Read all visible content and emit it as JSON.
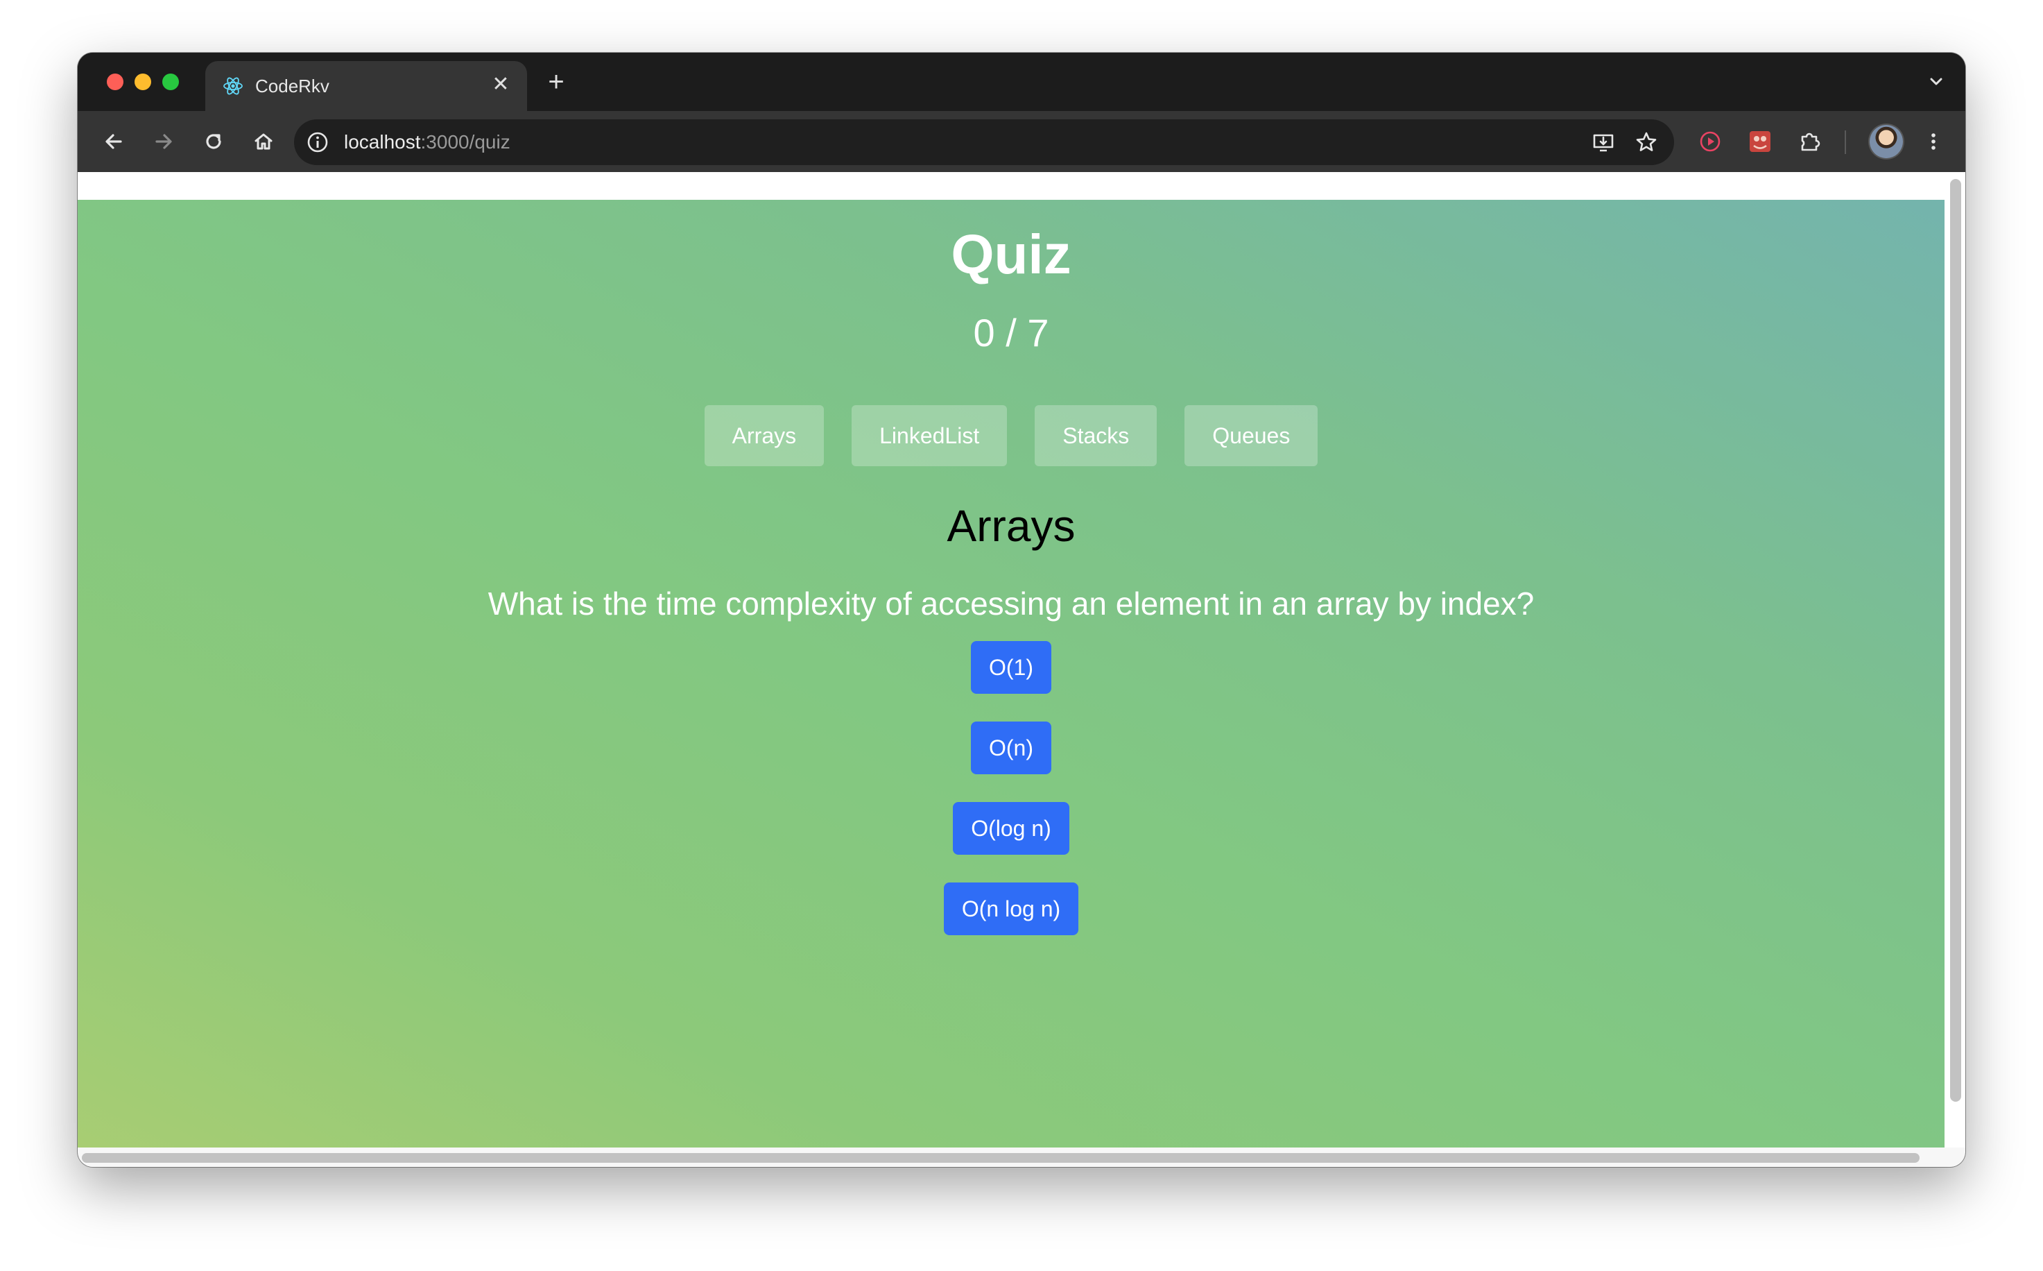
{
  "browser": {
    "tab": {
      "title": "CodeRkv",
      "close_symbol": "✕"
    },
    "new_tab_symbol": "+",
    "address": {
      "host": "localhost",
      "path": ":3000/quiz"
    }
  },
  "quiz": {
    "title": "Quiz",
    "score": "0 / 7",
    "categories": [
      "Arrays",
      "LinkedList",
      "Stacks",
      "Queues"
    ],
    "current_category": "Arrays",
    "question": "What is the time complexity of accessing an element in an array by index?",
    "answers": [
      "O(1)",
      "O(n)",
      "O(log n)",
      "O(n log n)"
    ]
  },
  "colors": {
    "answer_button": "#2f6df6",
    "gradient_start": "#a8cd73",
    "gradient_end": "#74b4ad"
  }
}
